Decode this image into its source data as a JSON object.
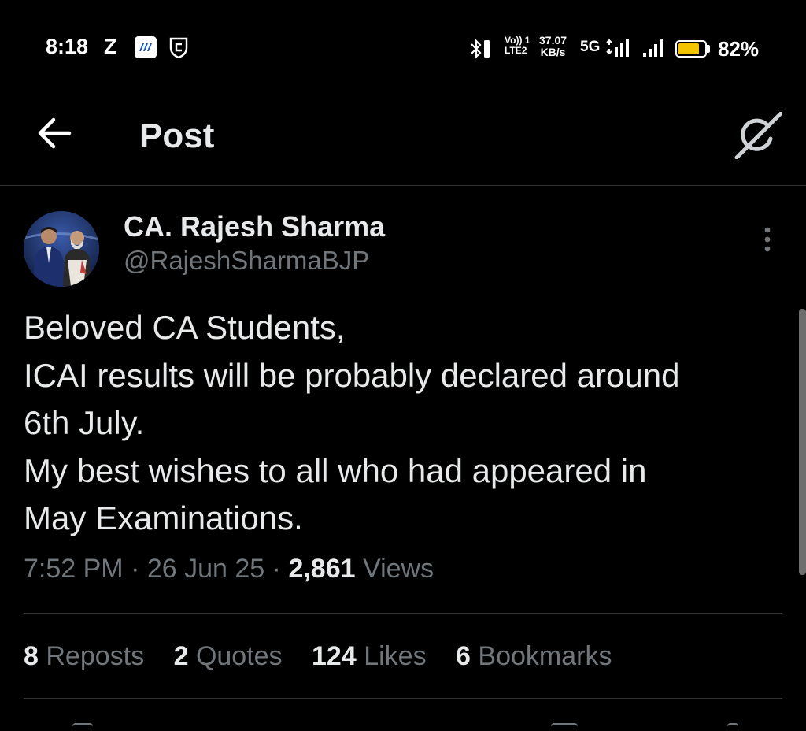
{
  "status_bar": {
    "time": "8:18",
    "carrier_icon_letter": "Z",
    "volte_line1": "Vo)) 1",
    "volte_line2": "LTE2",
    "speed_value": "37.07",
    "speed_unit": "KB/s",
    "network": "5G",
    "battery_percent": "82%",
    "battery_level": 0.82,
    "battery_color": "#f5c400",
    "icons": [
      "bluetooth-icon",
      "app-notification-icon",
      "shield-notification-icon",
      "signal-icon",
      "battery-icon"
    ]
  },
  "header": {
    "title": "Post",
    "back_icon": "arrow-left-icon",
    "grok_icon": "grok-icon"
  },
  "post": {
    "author_name": "CA. Rajesh Sharma",
    "author_handle": "@RajeshSharmaBJP",
    "more_icon": "vertical-dots-icon",
    "text_lines": [
      "Beloved CA Students,",
      "ICAI results will be probably declared around",
      "6th July.",
      "My best wishes to all who had appeared in",
      "May Examinations."
    ],
    "time": "7:52 PM",
    "separator": "·",
    "date": "26 Jun 25",
    "views_count": "2,861",
    "views_label": "Views"
  },
  "stats": [
    {
      "count": "8",
      "label": "Reposts"
    },
    {
      "count": "2",
      "label": "Quotes"
    },
    {
      "count": "124",
      "label": "Likes"
    },
    {
      "count": "6",
      "label": "Bookmarks"
    }
  ],
  "colors": {
    "background": "#000000",
    "text_primary": "#e7e9ea",
    "text_secondary": "#71767b",
    "divider": "#2f3336"
  }
}
